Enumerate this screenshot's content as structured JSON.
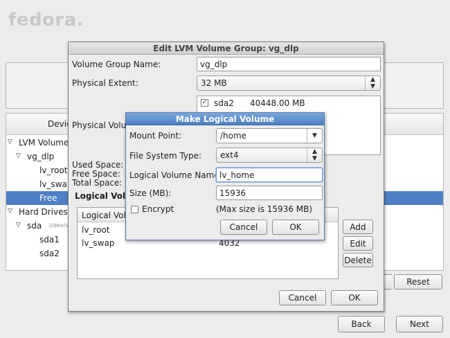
{
  "brand": "fedora.",
  "background": {
    "devices_header": "Devic",
    "tree": [
      {
        "label": "LVM Volume G",
        "level": 0,
        "expander": "▽"
      },
      {
        "label": "vg_dlp",
        "level": 1,
        "expander": "▽"
      },
      {
        "label": "lv_root",
        "level": 2,
        "expander": ""
      },
      {
        "label": "lv_swap",
        "level": 2,
        "expander": ""
      },
      {
        "label": "Free",
        "level": 2,
        "expander": "",
        "selected": true
      },
      {
        "label": "Hard Drives",
        "level": 0,
        "expander": "▽"
      },
      {
        "label": "sda",
        "level": 1,
        "expander": "▽",
        "sub": "(/dev/sd"
      },
      {
        "label": "sda1",
        "level": 2,
        "expander": ""
      },
      {
        "label": "sda2",
        "level": 2,
        "expander": ""
      }
    ],
    "reset_label": "Reset",
    "back_label": "Back",
    "next_label": "Next"
  },
  "vg_dialog": {
    "title": "Edit LVM Volume Group: vg_dlp",
    "vg_name_label": "Volume Group Name:",
    "vg_name_value": "vg_dlp",
    "pe_label": "Physical Extent:",
    "pe_value": "32 MB",
    "pv_label": "Physical Volum",
    "pv_list": [
      {
        "checked": true,
        "name": "sda2",
        "size": "40448.00 MB"
      }
    ],
    "used_label": "Used Space:",
    "free_label": "Free Space:",
    "total_label": "Total Space:",
    "lv_section_label": "Logical Volu",
    "lv_table_header": "Logical Volu",
    "lv_rows": [
      {
        "name": "lv_root",
        "size": ""
      },
      {
        "name": "lv_swap",
        "size": "4032"
      }
    ],
    "add_label": "Add",
    "edit_label": "Edit",
    "delete_label": "Delete",
    "cancel_label": "Cancel",
    "ok_label": "OK"
  },
  "lv_dialog": {
    "title": "Make Logical Volume",
    "mount_label": "Mount Point:",
    "mount_value": "/home",
    "fs_label": "File System Type:",
    "fs_value": "ext4",
    "lvname_label": "Logical Volume Name:",
    "lvname_value": "lv_home",
    "size_label": "Size (MB):",
    "size_value": "15936",
    "encrypt_label": "Encrypt",
    "encrypt_checked": false,
    "max_size_note": "(Max size is 15936 MB)",
    "cancel_label": "Cancel",
    "ok_label": "OK"
  },
  "colors": {
    "selection": "#4f7fc4",
    "lv_title_bar": "#5b8fd0",
    "vg_title_bar": "#d6d6d6"
  }
}
